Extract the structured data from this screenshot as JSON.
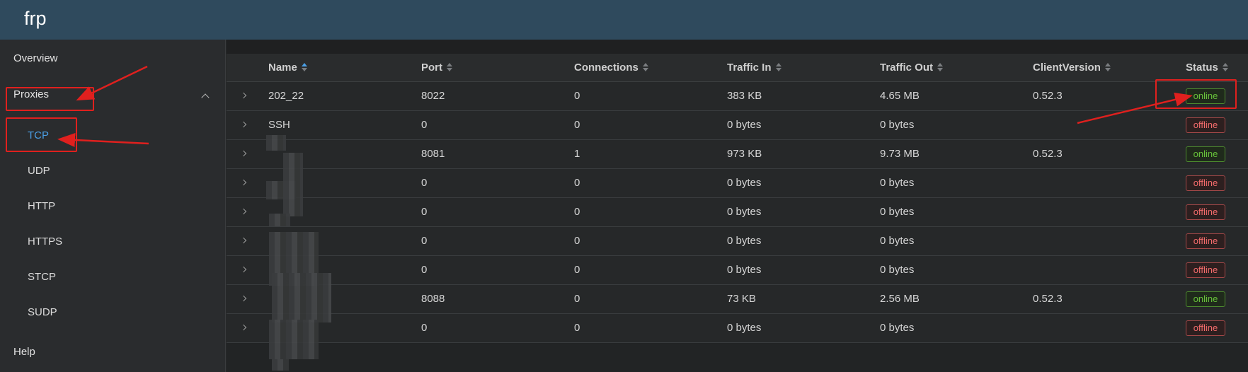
{
  "app": {
    "title": "frp"
  },
  "sidebar": {
    "overview": "Overview",
    "proxies": "Proxies",
    "sub": [
      "TCP",
      "UDP",
      "HTTP",
      "HTTPS",
      "STCP",
      "SUDP"
    ],
    "help": "Help"
  },
  "table": {
    "columns": [
      "Name",
      "Port",
      "Connections",
      "Traffic In",
      "Traffic Out",
      "ClientVersion",
      "Status"
    ],
    "rows": [
      {
        "name": "202_22",
        "port": "8022",
        "connections": "0",
        "traffic_in": "383 KB",
        "traffic_out": "4.65 MB",
        "client_version": "0.52.3",
        "status": "online"
      },
      {
        "name": "SSH",
        "port": "0",
        "connections": "0",
        "traffic_in": "0 bytes",
        "traffic_out": "0 bytes",
        "client_version": "",
        "status": "offline"
      },
      {
        "name": "",
        "port": "8081",
        "connections": "1",
        "traffic_in": "973 KB",
        "traffic_out": "9.73 MB",
        "client_version": "0.52.3",
        "status": "online"
      },
      {
        "name": "",
        "port": "0",
        "connections": "0",
        "traffic_in": "0 bytes",
        "traffic_out": "0 bytes",
        "client_version": "",
        "status": "offline"
      },
      {
        "name": "",
        "port": "0",
        "connections": "0",
        "traffic_in": "0 bytes",
        "traffic_out": "0 bytes",
        "client_version": "",
        "status": "offline"
      },
      {
        "name": "",
        "port": "0",
        "connections": "0",
        "traffic_in": "0 bytes",
        "traffic_out": "0 bytes",
        "client_version": "",
        "status": "offline"
      },
      {
        "name": "",
        "port": "0",
        "connections": "0",
        "traffic_in": "0 bytes",
        "traffic_out": "0 bytes",
        "client_version": "",
        "status": "offline"
      },
      {
        "name": "",
        "port": "8088",
        "connections": "0",
        "traffic_in": "73 KB",
        "traffic_out": "2.56 MB",
        "client_version": "0.52.3",
        "status": "online"
      },
      {
        "name": "",
        "port": "0",
        "connections": "0",
        "traffic_in": "0 bytes",
        "traffic_out": "0 bytes",
        "client_version": "",
        "status": "offline"
      }
    ]
  },
  "colors": {
    "header": "#2f4a5d",
    "accent": "#4a9fe6",
    "online": "#67c23a",
    "offline": "#f56c6c",
    "annotation": "#e0201e"
  },
  "icons": {
    "expand": "chevron-right-icon",
    "collapse": "chevron-up-icon",
    "sort": "sort-caret-icon"
  }
}
